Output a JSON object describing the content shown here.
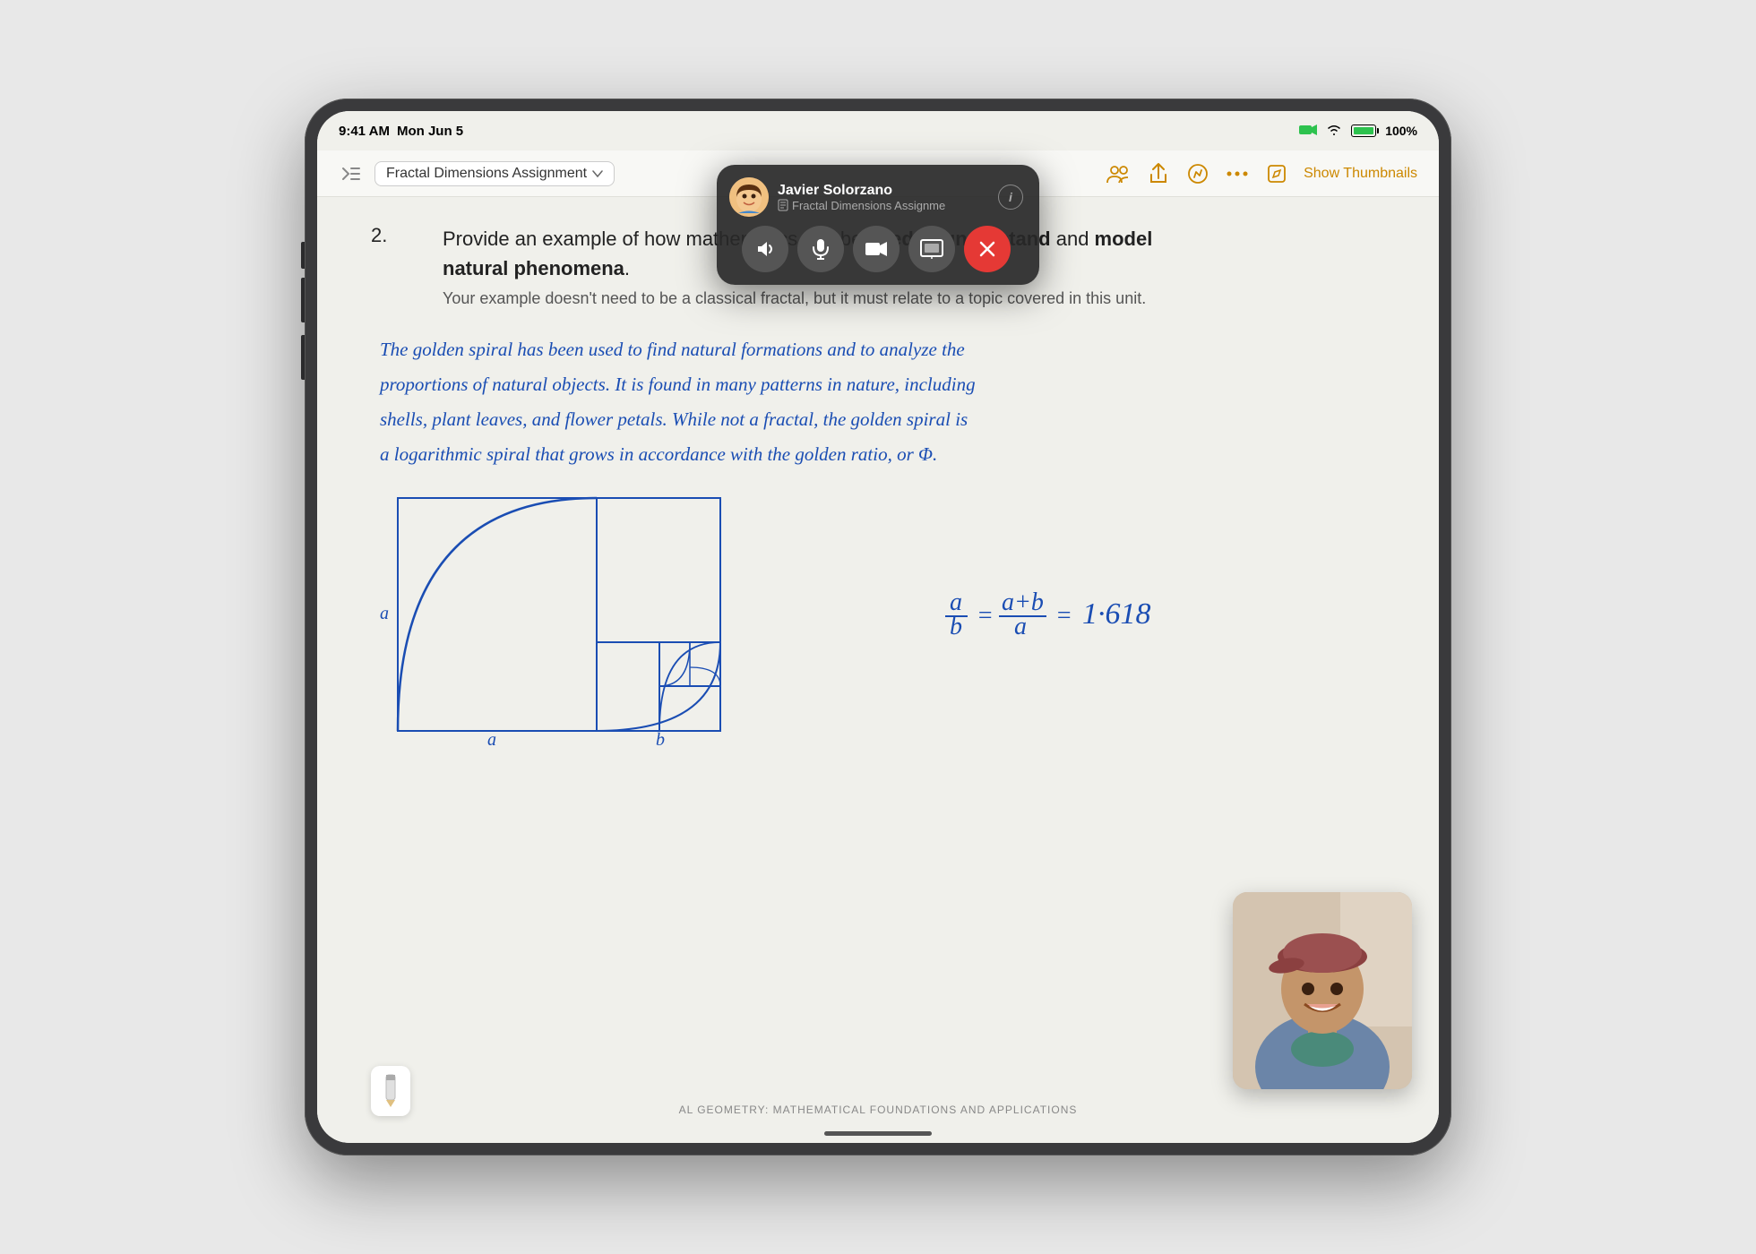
{
  "device": {
    "type": "iPad Pro",
    "background": "#e8e8e8"
  },
  "status_bar": {
    "time": "9:41 AM",
    "date": "Mon Jun 5",
    "battery_percent": "100%",
    "battery_icon": "battery-full-icon",
    "wifi_icon": "wifi-icon",
    "camera_icon": "camera-icon"
  },
  "toolbar": {
    "collapse_icon": "collapse-icon",
    "document_title": "Fractal Dimensions Assignment",
    "dropdown_icon": "chevron-down-icon",
    "show_thumbnails_label": "Show Thumbnails",
    "icons": [
      "people-icon",
      "share-icon",
      "markup-icon",
      "more-icon",
      "edit-icon"
    ]
  },
  "facetime": {
    "avatar_emoji": "🧑",
    "caller_name": "Javier Solorzano",
    "document_name": "Fractal Dimensions Assignme",
    "document_icon": "document-icon",
    "info_label": "i",
    "controls": [
      {
        "id": "volume",
        "icon": "🔊",
        "label": "volume-button"
      },
      {
        "id": "mic",
        "icon": "🎤",
        "label": "microphone-button"
      },
      {
        "id": "video",
        "icon": "📷",
        "label": "video-button"
      },
      {
        "id": "screen",
        "icon": "⬛",
        "label": "screen-share-button"
      },
      {
        "id": "end",
        "icon": "✕",
        "label": "end-call-button",
        "red": true
      }
    ]
  },
  "content": {
    "question_number": "2.",
    "question_main": "Provide an example of how mathematics can be used to understand and model natural phenomena.",
    "question_sub": "Your example doesn't need to be a classical fractal, but it must relate to a topic covered in this unit.",
    "handwritten_lines": [
      "The golden spiral has been used to find natural formations and to analyze the",
      "proportions of natural objects. It is found in many patterns in nature, including",
      "shells, plant leaves, and flower petals. While not a fractal, the golden spiral is",
      "a logarithmic spiral that grows in accordance with the golden ratio, or Φ."
    ],
    "formula": "a/b = (a+b)/a = 1.618",
    "diagram_label_a": "a",
    "diagram_label_b": "b",
    "diagram_label_a2": "a",
    "footer_text": "AL GEOMETRY: MATHEMATICAL FOUNDATIONS AND APPLICATIONS"
  },
  "colors": {
    "handwriting": "#1a4db3",
    "question_text": "#222222",
    "accent_orange": "#cc8800",
    "facetime_bg": "rgba(40,40,40,0.92)",
    "end_call": "#e53935",
    "control_btn": "#555555"
  }
}
